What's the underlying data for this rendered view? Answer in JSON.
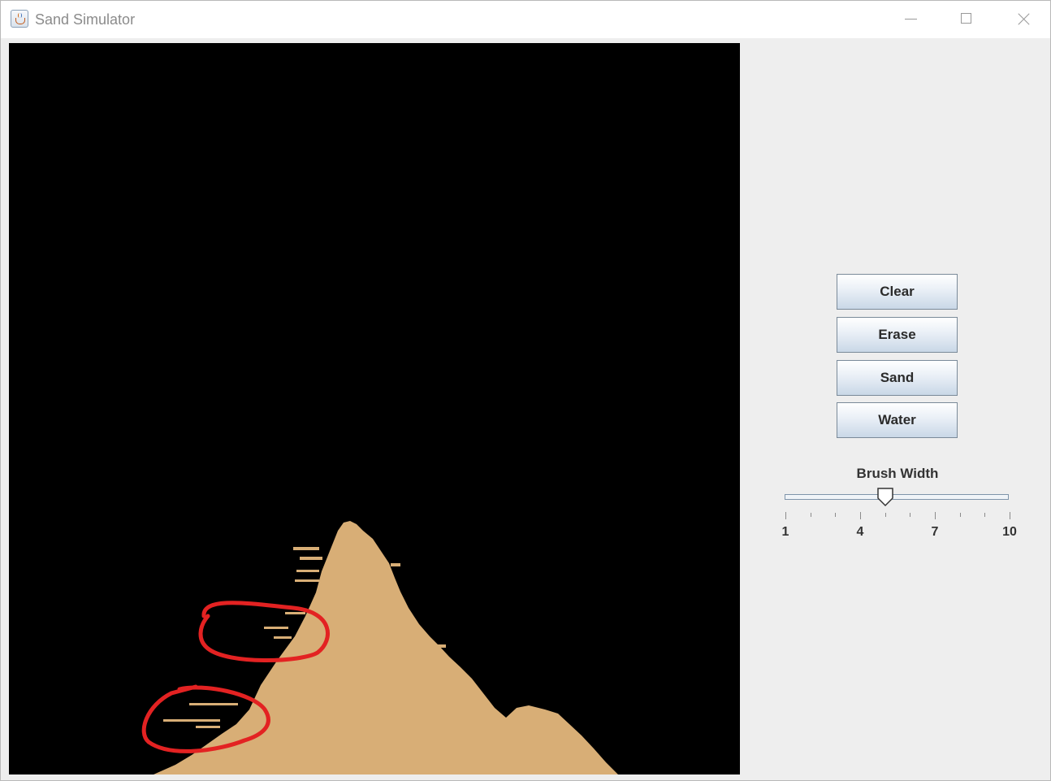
{
  "window": {
    "title": "Sand Simulator",
    "icon": "java-app-icon",
    "controls": [
      "minimize-icon",
      "maximize-icon",
      "close-icon"
    ]
  },
  "canvas": {
    "background_color": "#000000",
    "sand_color": "#d8ae76",
    "annotation_color": "#e32222"
  },
  "buttons": [
    {
      "id": "clear",
      "label": "Clear"
    },
    {
      "id": "erase",
      "label": "Erase"
    },
    {
      "id": "sand",
      "label": "Sand"
    },
    {
      "id": "water",
      "label": "Water"
    }
  ],
  "brush_slider": {
    "label": "Brush Width",
    "min": 1,
    "max": 10,
    "value": 5,
    "major_tick_labels": [
      "1",
      "4",
      "7",
      "10"
    ]
  }
}
